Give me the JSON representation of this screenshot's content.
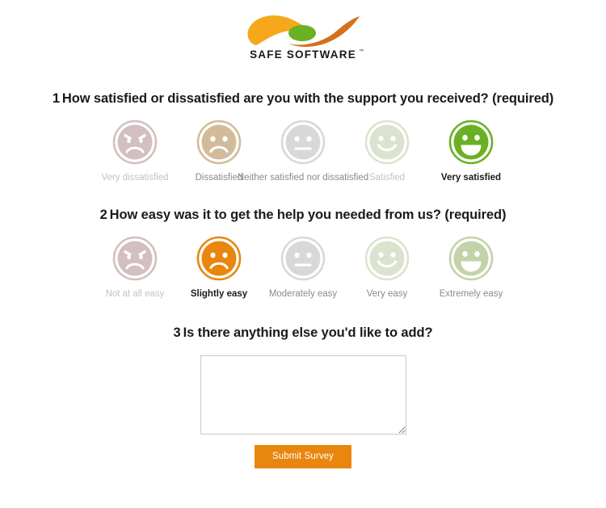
{
  "brand": {
    "name": "SAFE SOFTWARE",
    "trademark": "™",
    "logo_icon": "safe-software-swoosh-logo",
    "colors": {
      "swoosh_yellow": "#f5a81c",
      "swoosh_orange": "#d4701a",
      "swoosh_green": "#6ab023",
      "wordmark": "#1a1a1a"
    }
  },
  "questions": [
    {
      "number": "1",
      "text": "How satisfied or dissatisfied are you with the support you received? (required)",
      "required": true,
      "options": [
        {
          "label": "Very dissatisfied",
          "face": "angry",
          "color": "#d3bfc0",
          "selected": false,
          "tone": "dim"
        },
        {
          "label": "Dissatisfied",
          "face": "frown",
          "color": "#d2bb9b",
          "selected": false,
          "tone": "mid"
        },
        {
          "label": "Neither satisfied nor dissatisfied",
          "face": "neutral",
          "color": "#d8d8d8",
          "selected": false,
          "tone": "mid"
        },
        {
          "label": "Satisfied",
          "face": "smile",
          "color": "#dbe3ce",
          "selected": false,
          "tone": "dim"
        },
        {
          "label": "Very satisfied",
          "face": "grin",
          "color": "#6ab023",
          "selected": true,
          "tone": "sel"
        }
      ]
    },
    {
      "number": "2",
      "text": "How easy was it to get the help you needed from us? (required)",
      "required": true,
      "options": [
        {
          "label": "Not at all easy",
          "face": "angry",
          "color": "#d3bfc0",
          "selected": false,
          "tone": "dim"
        },
        {
          "label": "Slightly easy",
          "face": "frown",
          "color": "#e8860d",
          "selected": true,
          "tone": "sel"
        },
        {
          "label": "Moderately easy",
          "face": "neutral",
          "color": "#d8d8d8",
          "selected": false,
          "tone": "mid"
        },
        {
          "label": "Very easy",
          "face": "smile",
          "color": "#dbe3ce",
          "selected": false,
          "tone": "mid"
        },
        {
          "label": "Extremely easy",
          "face": "grin",
          "color": "#c3d2a8",
          "selected": false,
          "tone": "mid"
        }
      ]
    },
    {
      "number": "3",
      "text": "Is there anything else you'd like to add?",
      "required": false
    }
  ],
  "comment": {
    "value": "",
    "placeholder": ""
  },
  "submit": {
    "label": "Submit Survey",
    "color": "#e8860d"
  }
}
